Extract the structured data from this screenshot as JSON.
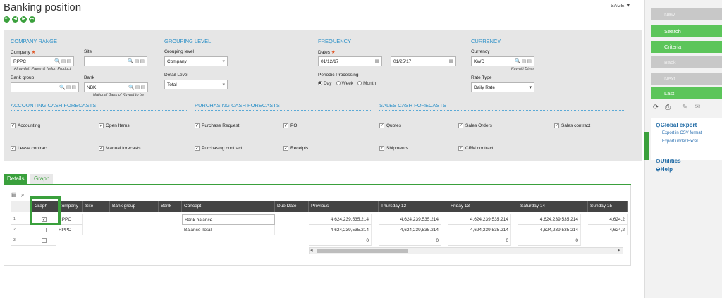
{
  "title": "Banking position",
  "user": "SAGE ▼",
  "nav": [
    "⏮",
    "◀",
    "▶",
    "⏭"
  ],
  "sections": {
    "company_range": "COMPANY RANGE",
    "grouping_level": "GROUPING LEVEL",
    "frequency": "FREQUENCY",
    "currency": "CURRENCY",
    "accounting": "ACCOUNTING CASH FORECASTS",
    "purchasing": "PURCHASING CASH FORECASTS",
    "sales": "SALES CASH FORECASTS"
  },
  "fields": {
    "company_label": "Company",
    "company_value": "RPPC",
    "company_desc": "Alrawdah Paper & Nylon Product",
    "site_label": "Site",
    "site_value": "",
    "bank_group_label": "Bank group",
    "bank_group_value": "",
    "bank_label": "Bank",
    "bank_value": "NBK",
    "bank_desc": "National Bank of Kuwait to be",
    "grouping_label": "Grouping level",
    "grouping_value": "Company",
    "detail_label": "Detail Level",
    "detail_value": "Total",
    "dates_label": "Dates",
    "date_from": "01/12/17",
    "date_to": "01/25/17",
    "periodic_label": "Periodic Processing",
    "periodic_options": [
      "Day",
      "Week",
      "Month"
    ],
    "periodic_selected": "Day",
    "currency_label": "Currency",
    "currency_value": "KWD",
    "currency_desc": "Kuwaiti Dinar",
    "rate_label": "Rate Type",
    "rate_value": "Daily Rate"
  },
  "checkboxes": {
    "accounting": "Accounting",
    "open_items": "Open Items",
    "purchase_request": "Purchase Request",
    "po": "PO",
    "quotes": "Quotes",
    "sales_orders": "Sales Orders",
    "sales_contract": "Sales contract",
    "lease_contract": "Lease contract",
    "manual_forecasts": "Manual forecasts",
    "purchasing_contract": "Purchasing contract",
    "receipts": "Receipts",
    "shipments": "Shipments",
    "crm_contract": "CRM contract"
  },
  "tabs": {
    "details": "Details",
    "graph": "Graph"
  },
  "grid": {
    "columns": [
      "Graph",
      "Company",
      "Site",
      "Bank group",
      "Bank",
      "Concept",
      "Due Date",
      "Previous",
      "Thursday 12",
      "Friday 13",
      "Saturday 14",
      "Sunday 15"
    ],
    "rows": [
      {
        "n": "1",
        "company": "RPPC",
        "concept": "Bank balance",
        "v": [
          "4,624,239,535.214",
          "4,624,239,535.214",
          "4,624,239,535.214",
          "4,624,239,535.214",
          "4,624,2"
        ]
      },
      {
        "n": "2",
        "company": "RPPC",
        "concept": "Balance Total",
        "v": [
          "4,624,239,535.214",
          "4,624,239,535.214",
          "4,624,239,535.214",
          "4,624,239,535.214",
          "4,624,2"
        ]
      },
      {
        "n": "3",
        "company": "",
        "concept": "",
        "v": [
          "0",
          "0",
          "0",
          "0",
          ""
        ]
      }
    ]
  },
  "sidebar": {
    "buttons": [
      "New",
      "Search",
      "Criteria",
      "Back",
      "Next",
      "Last"
    ],
    "global_export": "Global export",
    "export_csv": "Export in CSV format",
    "export_excel": "Export under Excel",
    "utilities": "Utilities",
    "help": "Help"
  },
  "colors": {
    "accent": "#3aa03c",
    "header": "#444444",
    "section": "#2a8fc7"
  }
}
